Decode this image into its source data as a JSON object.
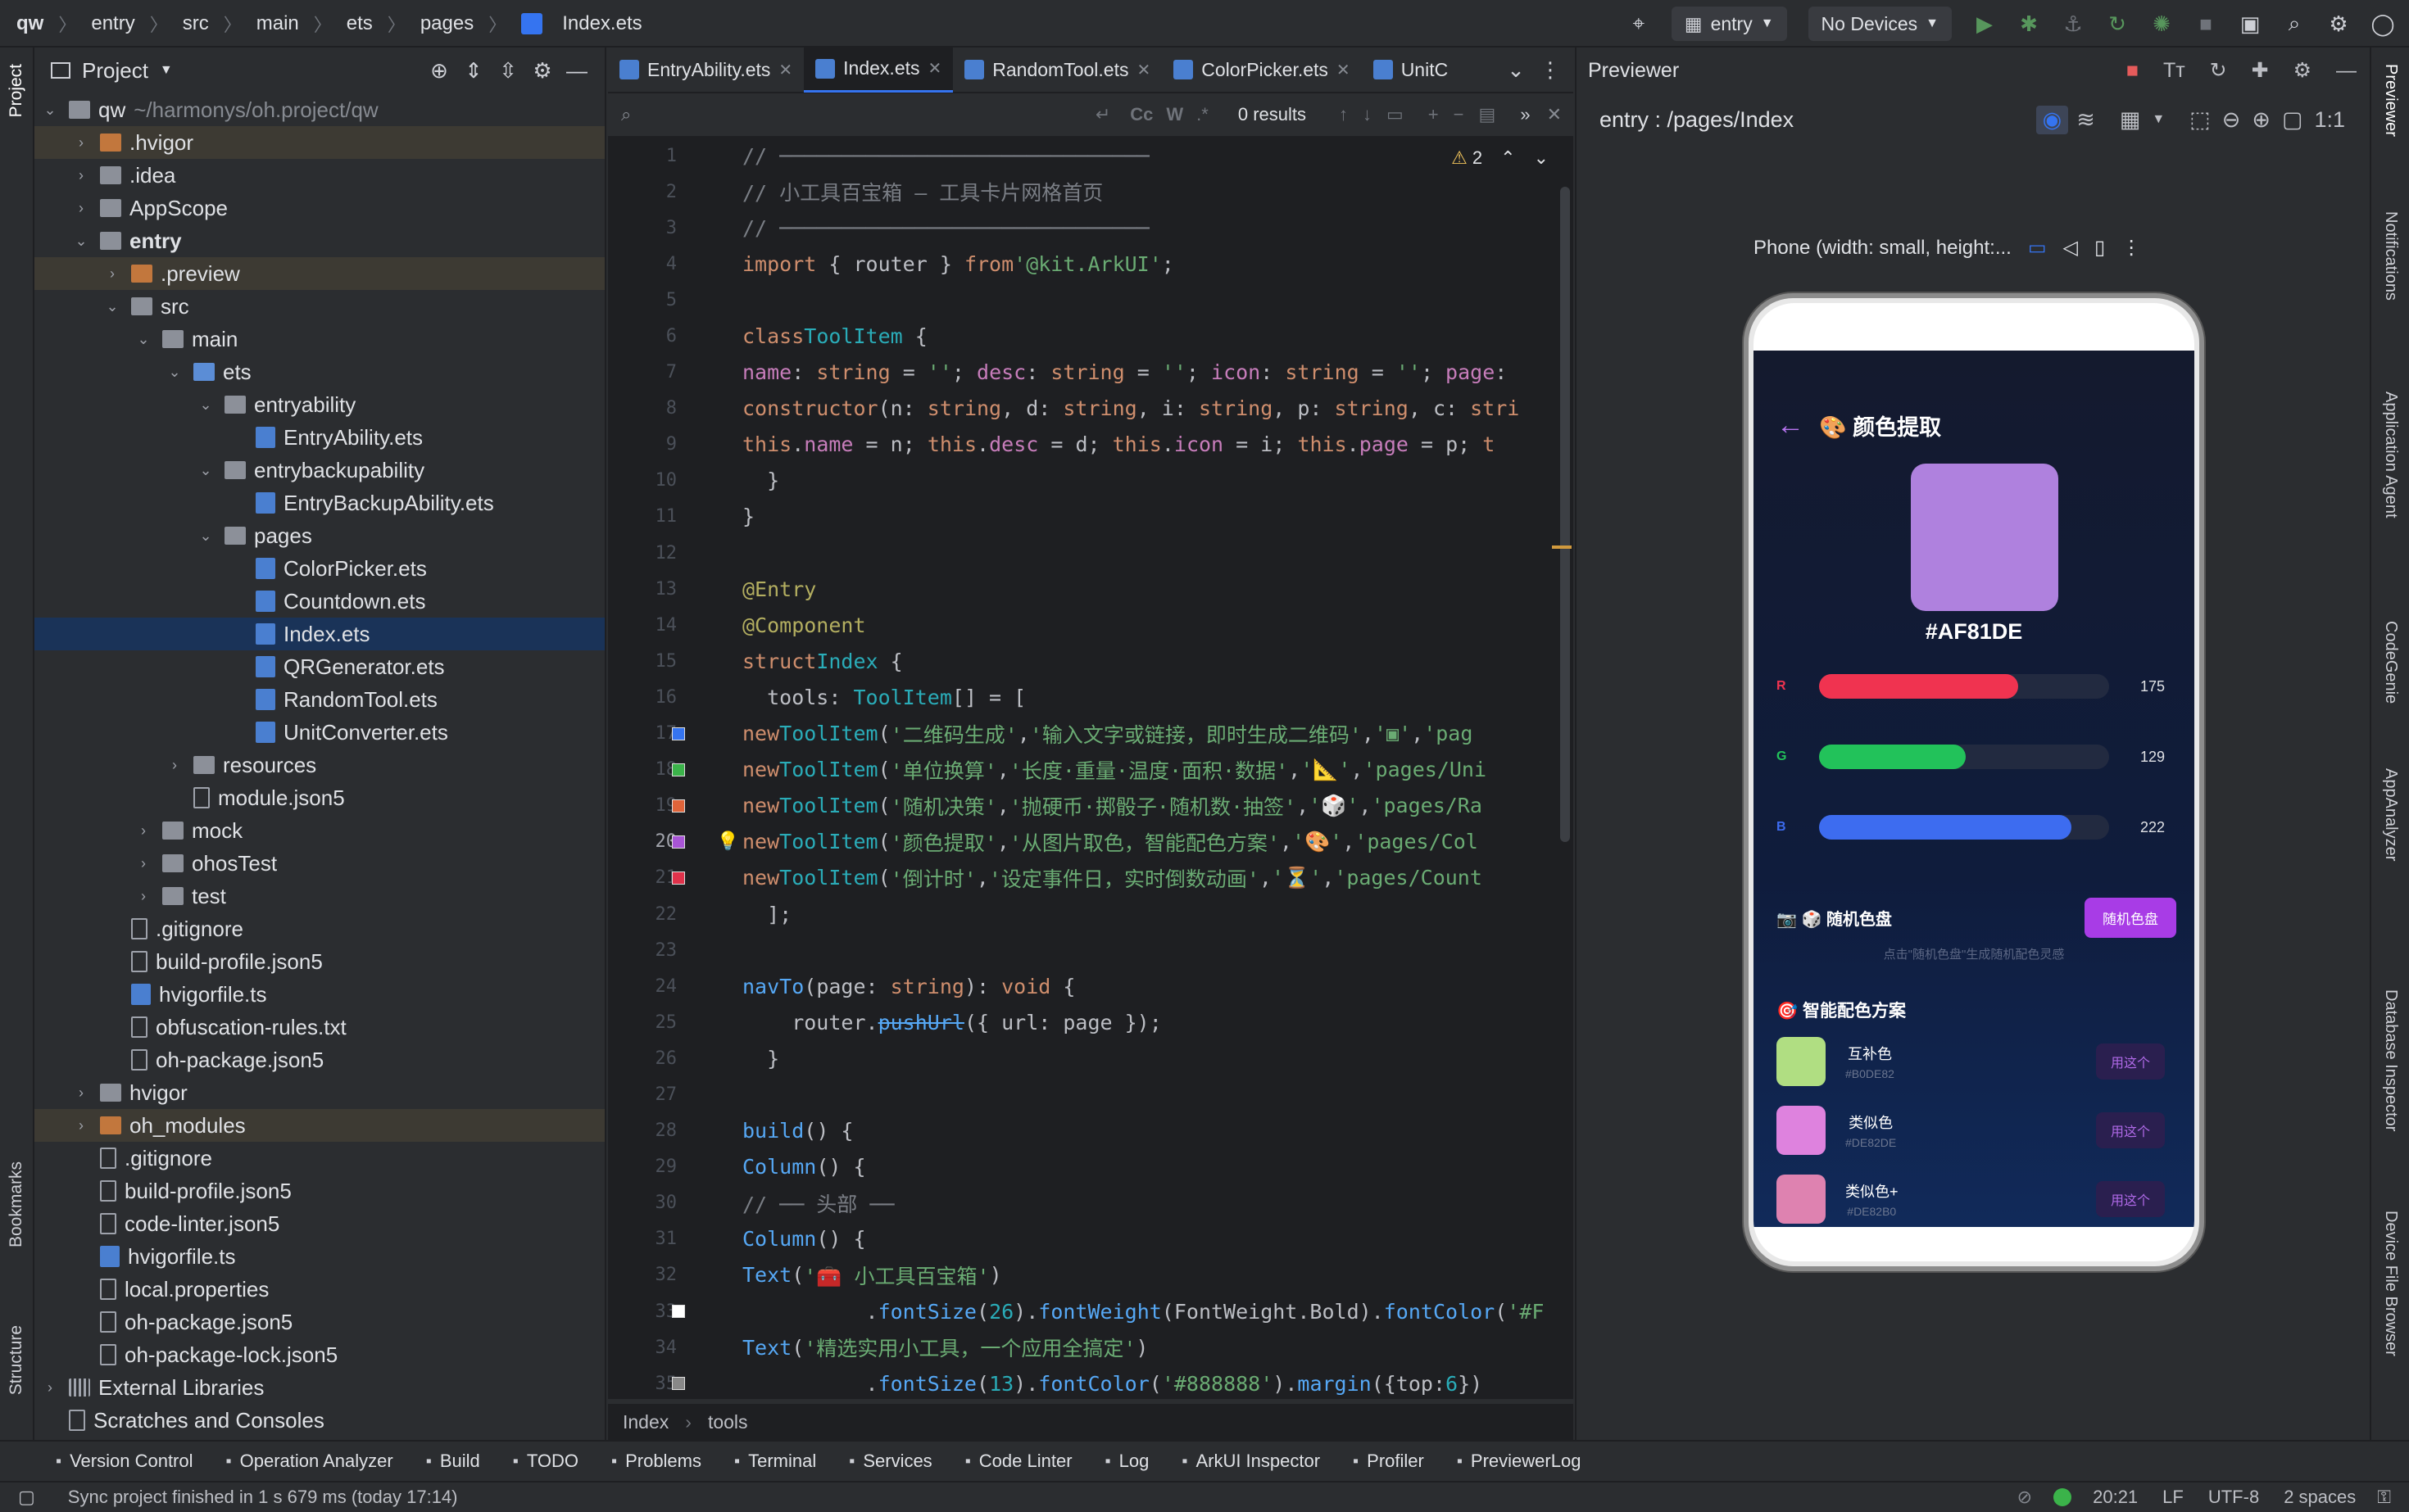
{
  "breadcrumb": [
    "qw",
    "entry",
    "src",
    "main",
    "ets",
    "pages",
    "Index.ets"
  ],
  "toolbar": {
    "run_config": "entry",
    "device": "No Devices"
  },
  "left_strip": {
    "project": "Project",
    "bookmarks": "Bookmarks",
    "structure": "Structure"
  },
  "project_panel": {
    "title": "Project",
    "tree": [
      {
        "label": "qw",
        "extra": "~/harmonys/oh.project/qw",
        "depth": 0,
        "chev": "open",
        "icon": "folder"
      },
      {
        "label": ".hvigor",
        "depth": 1,
        "chev": "closed",
        "icon": "folder-orange",
        "hl": true
      },
      {
        "label": ".idea",
        "depth": 1,
        "chev": "closed",
        "icon": "folder"
      },
      {
        "label": "AppScope",
        "depth": 1,
        "chev": "closed",
        "icon": "folder"
      },
      {
        "label": "entry",
        "depth": 1,
        "chev": "open",
        "icon": "folder",
        "bold": true
      },
      {
        "label": ".preview",
        "depth": 2,
        "chev": "closed",
        "icon": "folder-orange",
        "hl": true
      },
      {
        "label": "src",
        "depth": 2,
        "chev": "open",
        "icon": "folder"
      },
      {
        "label": "main",
        "depth": 3,
        "chev": "open",
        "icon": "folder"
      },
      {
        "label": "ets",
        "depth": 4,
        "chev": "open",
        "icon": "folder-blue"
      },
      {
        "label": "entryability",
        "depth": 5,
        "chev": "open",
        "icon": "folder"
      },
      {
        "label": "EntryAbility.ets",
        "depth": 6,
        "chev": "",
        "icon": "ets"
      },
      {
        "label": "entrybackupability",
        "depth": 5,
        "chev": "open",
        "icon": "folder"
      },
      {
        "label": "EntryBackupAbility.ets",
        "depth": 6,
        "chev": "",
        "icon": "ets"
      },
      {
        "label": "pages",
        "depth": 5,
        "chev": "open",
        "icon": "folder"
      },
      {
        "label": "ColorPicker.ets",
        "depth": 6,
        "chev": "",
        "icon": "ets"
      },
      {
        "label": "Countdown.ets",
        "depth": 6,
        "chev": "",
        "icon": "ets"
      },
      {
        "label": "Index.ets",
        "depth": 6,
        "chev": "",
        "icon": "ets",
        "sel": true
      },
      {
        "label": "QRGenerator.ets",
        "depth": 6,
        "chev": "",
        "icon": "ets"
      },
      {
        "label": "RandomTool.ets",
        "depth": 6,
        "chev": "",
        "icon": "ets"
      },
      {
        "label": "UnitConverter.ets",
        "depth": 6,
        "chev": "",
        "icon": "ets"
      },
      {
        "label": "resources",
        "depth": 4,
        "chev": "closed",
        "icon": "folder"
      },
      {
        "label": "module.json5",
        "depth": 4,
        "chev": "",
        "icon": "file"
      },
      {
        "label": "mock",
        "depth": 3,
        "chev": "closed",
        "icon": "folder"
      },
      {
        "label": "ohosTest",
        "depth": 3,
        "chev": "closed",
        "icon": "folder"
      },
      {
        "label": "test",
        "depth": 3,
        "chev": "closed",
        "icon": "folder"
      },
      {
        "label": ".gitignore",
        "depth": 2,
        "chev": "",
        "icon": "file"
      },
      {
        "label": "build-profile.json5",
        "depth": 2,
        "chev": "",
        "icon": "file"
      },
      {
        "label": "hvigorfile.ts",
        "depth": 2,
        "chev": "",
        "icon": "ets"
      },
      {
        "label": "obfuscation-rules.txt",
        "depth": 2,
        "chev": "",
        "icon": "file"
      },
      {
        "label": "oh-package.json5",
        "depth": 2,
        "chev": "",
        "icon": "file"
      },
      {
        "label": "hvigor",
        "depth": 1,
        "chev": "closed",
        "icon": "folder"
      },
      {
        "label": "oh_modules",
        "depth": 1,
        "chev": "closed",
        "icon": "folder-orange",
        "hl": true
      },
      {
        "label": ".gitignore",
        "depth": 1,
        "chev": "",
        "icon": "file"
      },
      {
        "label": "build-profile.json5",
        "depth": 1,
        "chev": "",
        "icon": "file"
      },
      {
        "label": "code-linter.json5",
        "depth": 1,
        "chev": "",
        "icon": "file"
      },
      {
        "label": "hvigorfile.ts",
        "depth": 1,
        "chev": "",
        "icon": "ets"
      },
      {
        "label": "local.properties",
        "depth": 1,
        "chev": "",
        "icon": "file"
      },
      {
        "label": "oh-package.json5",
        "depth": 1,
        "chev": "",
        "icon": "file"
      },
      {
        "label": "oh-package-lock.json5",
        "depth": 1,
        "chev": "",
        "icon": "file"
      },
      {
        "label": "External Libraries",
        "depth": 0,
        "chev": "closed",
        "icon": "lib"
      },
      {
        "label": "Scratches and Consoles",
        "depth": 0,
        "chev": "",
        "icon": "file"
      }
    ]
  },
  "editor": {
    "tabs": [
      "EntryAbility.ets",
      "Index.ets",
      "RandomTool.ets",
      "ColorPicker.ets",
      "UnitC"
    ],
    "active_tab": 1,
    "find_results": "0 results",
    "find_toggles": [
      "Cc",
      "W",
      ".*"
    ],
    "warnings": "2",
    "current_line": 20,
    "lines": [
      {
        "n": 1,
        "html": "<span class='cmt'>// ──────────────────────────────</span>"
      },
      {
        "n": 2,
        "html": "<span class='cmt'>// 小工具百宝箱 — 工具卡片网格首页</span>"
      },
      {
        "n": 3,
        "html": "<span class='cmt'>// ──────────────────────────────</span>"
      },
      {
        "n": 4,
        "html": "<span class='kw'>import</span> { router } <span class='kw'>from</span> <span class='str'>'@kit.ArkUI'</span>;"
      },
      {
        "n": 5,
        "html": ""
      },
      {
        "n": 6,
        "html": "<span class='kw'>class</span> <span class='cls'>ToolItem</span> {"
      },
      {
        "n": 7,
        "html": "  <span class='prop'>name</span>: <span class='kw'>string</span> = <span class='str'>''</span>; <span class='prop'>desc</span>: <span class='kw'>string</span> = <span class='str'>''</span>; <span class='prop'>icon</span>: <span class='kw'>string</span> = <span class='str'>''</span>; <span class='prop'>page</span>:"
      },
      {
        "n": 8,
        "html": "  <span class='kw'>constructor</span>(n: <span class='kw'>string</span>, d: <span class='kw'>string</span>, i: <span class='kw'>string</span>, p: <span class='kw'>string</span>, c: <span class='kw'>stri</span>"
      },
      {
        "n": 9,
        "html": "    <span class='kw'>this</span>.<span class='prop'>name</span> = n; <span class='kw'>this</span>.<span class='prop'>desc</span> = d; <span class='kw'>this</span>.<span class='prop'>icon</span> = i; <span class='kw'>this</span>.<span class='prop'>page</span> = p; <span class='kw'>t</span>"
      },
      {
        "n": 10,
        "html": "  }"
      },
      {
        "n": 11,
        "html": "}"
      },
      {
        "n": 12,
        "html": ""
      },
      {
        "n": 13,
        "html": "<span class='ann'>@Entry</span>"
      },
      {
        "n": 14,
        "html": "<span class='ann'>@Component</span>"
      },
      {
        "n": 15,
        "html": "<span class='kw'>struct</span> <span class='cls'>Index</span> {"
      },
      {
        "n": 16,
        "html": "  tools: <span class='cls'>ToolItem</span>[] = ["
      },
      {
        "n": 17,
        "html": "    <span class='kw'>new</span> <span class='cls'>ToolItem</span>(<span class='str'>'二维码生成'</span>,<span class='str'>'输入文字或链接，即时生成二维码'</span>,<span class='str'>'▣'</span>,<span class='str'>'pag</span>"
      },
      {
        "n": 18,
        "html": "    <span class='kw'>new</span> <span class='cls'>ToolItem</span>(<span class='str'>'单位换算'</span>,<span class='str'>'长度·重量·温度·面积·数据'</span>,<span class='str'>'📐'</span>,<span class='str'>'pages/Uni</span>"
      },
      {
        "n": 19,
        "html": "    <span class='kw'>new</span> <span class='cls'>ToolItem</span>(<span class='str'>'随机决策'</span>,<span class='str'>'抛硬币·掷骰子·随机数·抽签'</span>,<span class='str'>'🎲'</span>,<span class='str'>'pages/Ra</span>"
      },
      {
        "n": 20,
        "html": "    <span class='kw'>new</span> <span class='cls'>ToolItem</span>(<span class='str'>'颜色提取'</span>,<span class='str'>'从图片取色，智能配色方案'</span>,<span class='str'>'🎨'</span>,<span class='str'>'pages/Col</span>"
      },
      {
        "n": 21,
        "html": "    <span class='kw'>new</span> <span class='cls'>ToolItem</span>(<span class='str'>'倒计时'</span>,<span class='str'>'设定事件日，实时倒数动画'</span>,<span class='str'>'⏳'</span>,<span class='str'>'pages/Count</span>"
      },
      {
        "n": 22,
        "html": "  ];"
      },
      {
        "n": 23,
        "html": ""
      },
      {
        "n": 24,
        "html": "  <span class='fn'>navTo</span>(page: <span class='kw'>string</span>): <span class='kw'>void</span> {"
      },
      {
        "n": 25,
        "html": "    router.<span class='fn' style='text-decoration:line-through'>pushUrl</span>({ url: page });"
      },
      {
        "n": 26,
        "html": "  }"
      },
      {
        "n": 27,
        "html": ""
      },
      {
        "n": 28,
        "html": "  <span class='fn'>build</span>() {"
      },
      {
        "n": 29,
        "html": "    <span class='fn'>Column</span>() {"
      },
      {
        "n": 30,
        "html": "      <span class='cmt'>// ── 头部 ──</span>"
      },
      {
        "n": 31,
        "html": "      <span class='fn'>Column</span>() {"
      },
      {
        "n": 32,
        "html": "        <span class='fn'>Text</span>(<span class='str'>'🧰 小工具百宝箱'</span>)"
      },
      {
        "n": 33,
        "html": "          .<span class='fn'>fontSize</span>(<span class='num'>26</span>).<span class='fn'>fontWeight</span>(FontWeight.Bold).<span class='fn'>fontColor</span>(<span class='str'>'#F</span>"
      },
      {
        "n": 34,
        "html": "        <span class='fn'>Text</span>(<span class='str'>'精选实用小工具，一个应用全搞定'</span>)"
      },
      {
        "n": 35,
        "html": "          .<span class='fn'>fontSize</span>(<span class='num'>13</span>).<span class='fn'>fontColor</span>(<span class='str'>'#888888'</span>).<span class='fn'>margin</span>({top:<span class='num'>6</span>})"
      }
    ],
    "gutter_swatches": {
      "17": "#3574f0",
      "18": "#3bb34a",
      "19": "#e0643a",
      "20": "#a855d6",
      "21": "#e0324b",
      "33": "#ffffff",
      "35": "#888888"
    },
    "breadcrumb": [
      "Index",
      "tools"
    ]
  },
  "previewer": {
    "title": "Previewer",
    "route": "entry : /pages/Index",
    "device_label": "Phone (width: small, height:..."
  },
  "app": {
    "title": "🎨 颜色提取",
    "swatch_color": "#AF81DE",
    "hex": "#AF81DE",
    "channels": [
      {
        "label": "R",
        "value": "175",
        "fill": 0.686,
        "color": "#f03350"
      },
      {
        "label": "G",
        "value": "129",
        "fill": 0.506,
        "color": "#22c25a"
      },
      {
        "label": "B",
        "value": "222",
        "fill": 0.871,
        "color": "#3d6cf0"
      }
    ],
    "random_section": {
      "title": "📷 🎲 随机色盘",
      "button": "随机色盘",
      "hint": "点击\"随机色盘\"生成随机配色灵感"
    },
    "scheme_section": {
      "title": "🎯 智能配色方案",
      "items": [
        {
          "name": "互补色",
          "hex": "#B0DE82",
          "color": "#B0DE82",
          "button": "用这个"
        },
        {
          "name": "类似色",
          "hex": "#DE82DE",
          "color": "#DE82DE",
          "button": "用这个"
        },
        {
          "name": "类似色+",
          "hex": "#DE82B0",
          "color": "#DE82B0",
          "button": "用这个"
        }
      ]
    }
  },
  "right_strip": [
    "Previewer",
    "Notifications",
    "Application Agent",
    "CodeGenie",
    "AppAnalyzer",
    "Database Inspector",
    "Device File Browser"
  ],
  "tool_windows": [
    "Version Control",
    "Operation Analyzer",
    "Build",
    "TODO",
    "Problems",
    "Terminal",
    "Services",
    "Code Linter",
    "Log",
    "ArkUI Inspector",
    "Profiler",
    "PreviewerLog"
  ],
  "status": {
    "message": "Sync project finished in 1 s 679 ms (today 17:14)",
    "position": "20:21",
    "line_sep": "LF",
    "encoding": "UTF-8",
    "indent": "2 spaces"
  },
  "colors": {
    "accent": "#3574f0",
    "selection": "#1a3358",
    "app_button": "#a83ce6"
  }
}
